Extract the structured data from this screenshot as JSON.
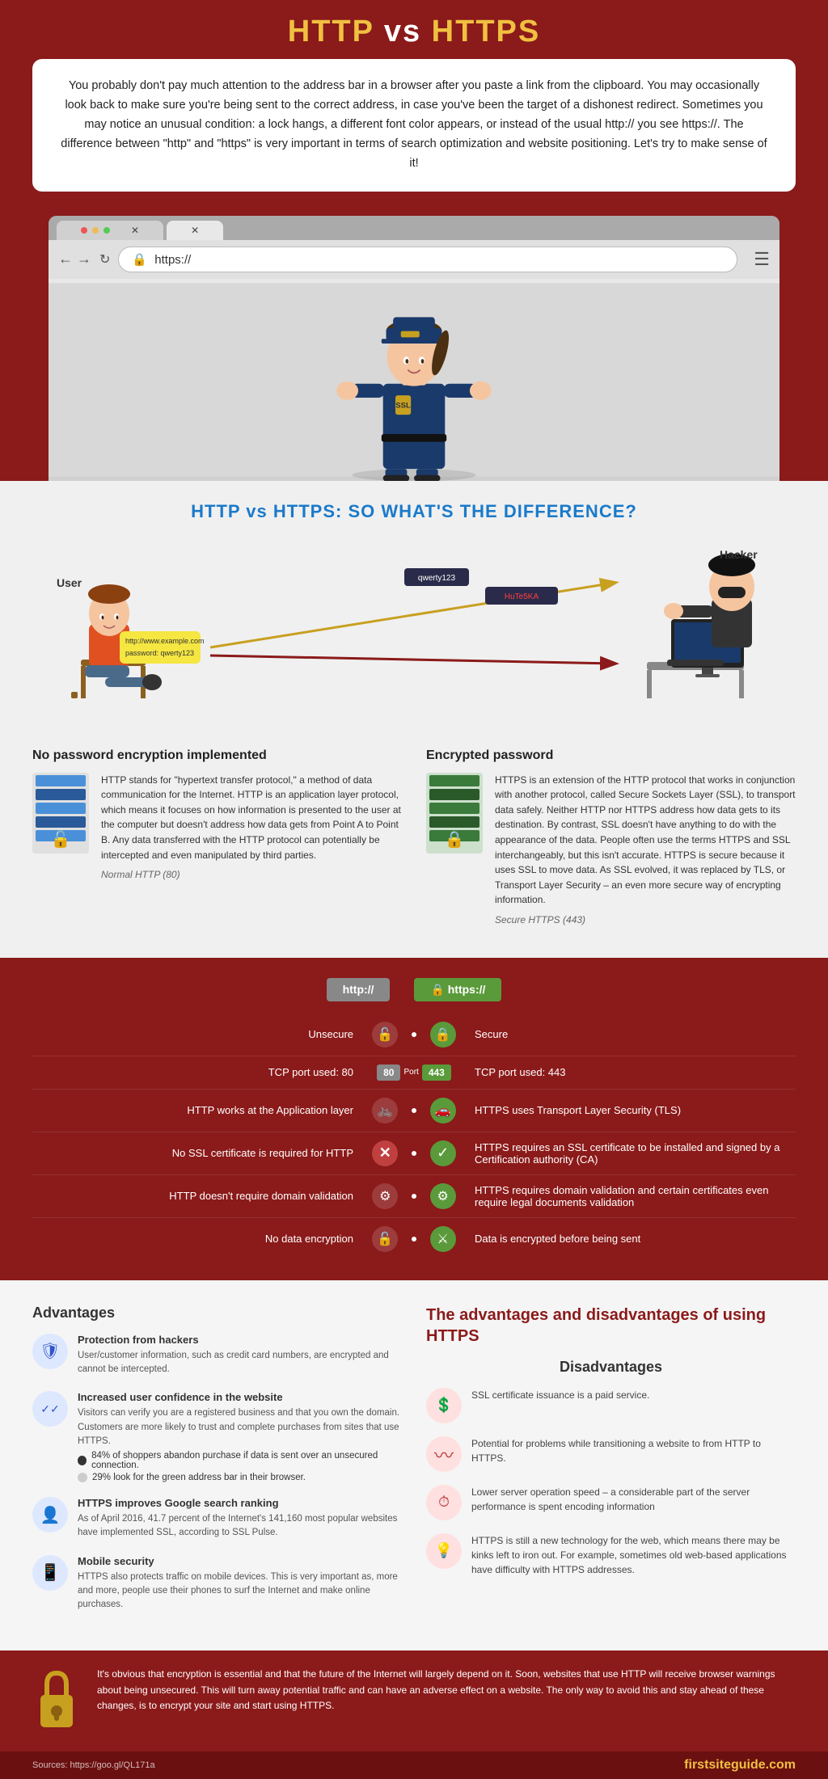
{
  "header": {
    "title_http": "HTTP",
    "title_vs": " vs ",
    "title_https": "HTTPS"
  },
  "intro": {
    "text": "You probably don't pay much attention to the address bar in a browser after you paste a link from the clipboard. You may occasionally look back to make sure you're being sent to the correct address, in case you've been the target of a dishonest redirect. Sometimes you may notice an unusual condition: a lock hangs, a different font color appears, or instead of the usual http:// you see https://. The difference between \"http\" and \"https\" is very important in terms of search optimization and website positioning. Let's try to make sense of it!"
  },
  "browser": {
    "address": "https://",
    "tab1": "✕",
    "tab2": "✕"
  },
  "difference": {
    "title": "HTTP vs HTTPS: SO WHAT'S THE DIFFERENCE?",
    "user_label": "User",
    "hacker_label": "Hacker",
    "user_bubble": "http://www.example.com\npassword: qwerty123",
    "hacker_bubble1": "qwerty123",
    "hacker_bubble2": "HuTe5KA"
  },
  "http_section": {
    "title": "No password encryption implemented",
    "label": "Normal HTTP (80)",
    "text": "HTTP stands for \"hypertext transfer protocol,\" a method of data communication for the Internet.\nHTTP is an application layer protocol, which means it focuses on how information is presented to the user at the computer but doesn't address how data gets from Point A to Point B. Any data transferred with the HTTP protocol can potentially be intercepted and even manipulated by third parties."
  },
  "https_section": {
    "title": "Encrypted password",
    "label": "Secure HTTPS (443)",
    "text": "HTTPS is an extension of the HTTP protocol that works in conjunction with another protocol, called Secure Sockets Layer (SSL), to transport data safely.\nNeither HTTP nor HTTPS address how data gets to its destination. By contrast, SSL doesn't have anything to do with the appearance of the data.\nPeople often use the terms HTTPS and SSL interchangeably, but this isn't accurate. HTTPS is secure because it uses SSL to move data. As SSL evolved, it was replaced by TLS, or Transport Layer Security – an even more secure way of encrypting information."
  },
  "feature_table": {
    "http_badge": "http://",
    "https_badge": "🔒 https://",
    "rows": [
      {
        "left": "Unsecure",
        "right": "Secure",
        "left_icon": "🔓",
        "right_icon": "🔒"
      },
      {
        "left": "TCP port used: 80",
        "right": "TCP port used: 443",
        "center": "80  Port  443"
      },
      {
        "left": "HTTP works at the Application layer",
        "right": "HTTPS uses Transport Layer Security (TLS)",
        "left_icon": "🚲",
        "right_icon": "🚗"
      },
      {
        "left": "No SSL certificate is required for HTTP",
        "right": "HTTPS requires an SSL certificate to be installed and signed by a Certification authority (CA)",
        "left_icon": "✕",
        "right_icon": "✓"
      },
      {
        "left": "HTTP doesn't require domain validation",
        "right": "HTTPS requires domain validation and certain certificates even require legal documents validation",
        "left_icon": "⚙",
        "right_icon": "⚙"
      },
      {
        "left": "No data encryption",
        "right": "Data is encrypted before being sent",
        "left_icon": "🔓",
        "right_icon": "⚔"
      }
    ]
  },
  "advantages": {
    "title": "Advantages",
    "items": [
      {
        "icon": "🛡",
        "title": "Protection from hackers",
        "text": "User/customer information, such as credit card numbers, are encrypted and cannot be intercepted."
      },
      {
        "icon": "✓",
        "title": "Increased user confidence in the website",
        "text": "Visitors can verify you are a registered business and that you own the domain. Customers are more likely to trust and complete purchases from sites that use HTTPS.",
        "stats": [
          "84% of shoppers abandon purchase if data is sent over an unsecured connection.",
          "29% look for the green address bar in their browser."
        ]
      },
      {
        "icon": "👤",
        "title": "HTTPS improves Google search ranking",
        "text": "As of April 2016, 41.7 percent of the Internet's 141,160 most popular websites have implemented SSL, according to SSL Pulse."
      },
      {
        "icon": "📱",
        "title": "Mobile security",
        "text": "HTTPS also protects traffic on mobile devices. This is very important as, more and more, people use their phones to surf the Internet and make online purchases."
      }
    ]
  },
  "disadvantages": {
    "title": "Disadvantages",
    "items": [
      {
        "icon": "💲",
        "text": "SSL certificate issuance is a paid service."
      },
      {
        "icon": "〰",
        "text": "Potential for problems while transitioning a website to from HTTP to HTTPS."
      },
      {
        "icon": "⏱",
        "text": "Lower server operation speed – a considerable part of the server performance is spent encoding information"
      },
      {
        "icon": "💡",
        "text": "HTTPS is still a new technology for the web, which means there may be kinks left to iron out. For example, sometimes old web-based applications have difficulty with HTTPS addresses."
      }
    ]
  },
  "adv_disadv_title": "The advantages and disadvantages of using HTTPS",
  "footer": {
    "text": "It's obvious that encryption is essential and that the future of the Internet will largely depend on it. Soon, websites that use HTTP will receive browser warnings about being unsecured. This will turn away potential traffic and can have an adverse effect on a website. The only way to avoid this and stay ahead of these changes, is to encrypt your site and start using HTTPS.",
    "source": "Sources: https://goo.gl/QL171a",
    "brand_first": "first",
    "brand_site": "site",
    "brand_guide": "guide",
    "brand_com": ".com"
  }
}
